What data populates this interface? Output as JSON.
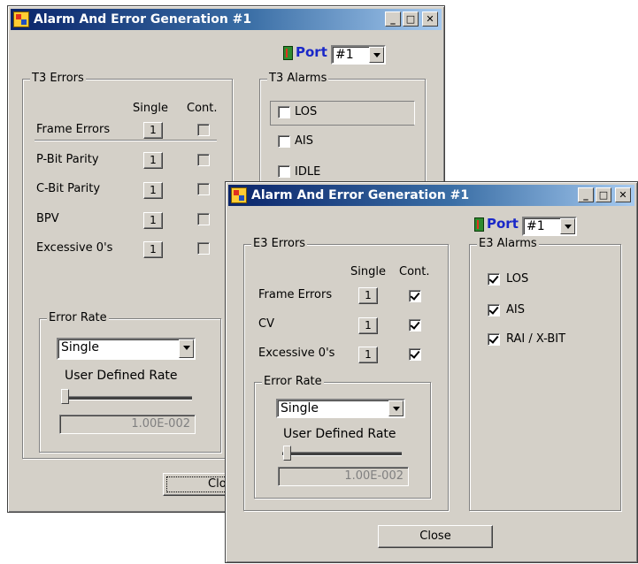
{
  "back_window": {
    "title": "Alarm And Error Generation #1",
    "port": {
      "label": "Port",
      "value": "#1"
    },
    "errors_group": {
      "label": "T3 Errors",
      "col_single": "Single",
      "col_cont": "Cont.",
      "rows": [
        {
          "label": "Frame Errors",
          "button": "1"
        },
        {
          "label": "P-Bit Parity",
          "button": "1"
        },
        {
          "label": "C-Bit Parity",
          "button": "1"
        },
        {
          "label": "BPV",
          "button": "1"
        },
        {
          "label": "Excessive 0's",
          "button": "1"
        }
      ]
    },
    "alarms_group": {
      "label": "T3 Alarms",
      "items": [
        {
          "label": "LOS"
        },
        {
          "label": "AIS"
        },
        {
          "label": "IDLE"
        }
      ]
    },
    "error_rate": {
      "label": "Error Rate",
      "mode": "Single",
      "user_defined_label": "User Defined Rate",
      "rate_value": "1.00E-002",
      "slider_level": 0
    },
    "close_label_partial": "Clo"
  },
  "front_window": {
    "title": "Alarm And Error Generation #1",
    "port": {
      "label": "Port",
      "value": "#1"
    },
    "errors_group": {
      "label": "E3 Errors",
      "col_single": "Single",
      "col_cont": "Cont.",
      "rows": [
        {
          "label": "Frame Errors",
          "button": "1",
          "cont_checked": true
        },
        {
          "label": "CV",
          "button": "1",
          "cont_checked": true
        },
        {
          "label": "Excessive 0's",
          "button": "1",
          "cont_checked": true
        }
      ]
    },
    "alarms_group": {
      "label": "E3 Alarms",
      "items": [
        {
          "label": "LOS",
          "checked": true
        },
        {
          "label": "AIS",
          "checked": true
        },
        {
          "label": "RAI / X-BIT",
          "checked": true
        }
      ]
    },
    "error_rate": {
      "label": "Error Rate",
      "mode": "Single",
      "user_defined_label": "User Defined Rate",
      "rate_value": "1.00E-002",
      "slider_level": 0
    },
    "close_label": "Close"
  },
  "colors": {
    "title_bar_start": "#0a246a",
    "title_bar_end": "#a6caf0",
    "port_label": "#1a28c8",
    "dialog_face": "#d4d0c8"
  }
}
